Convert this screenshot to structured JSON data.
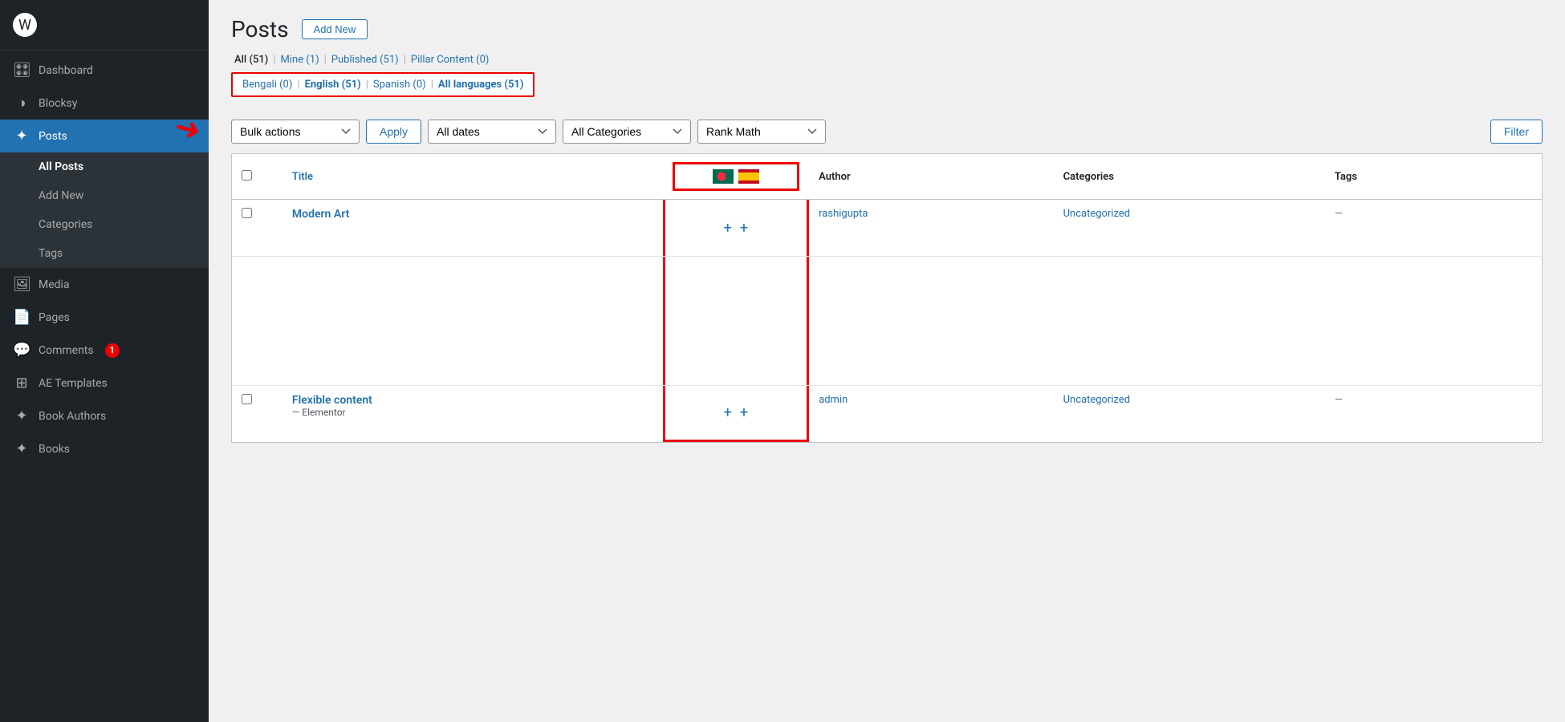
{
  "sidebar": {
    "items": [
      {
        "id": "dashboard",
        "label": "Dashboard",
        "icon": "🎛"
      },
      {
        "id": "blocksy",
        "label": "Blocksy",
        "icon": "◑"
      },
      {
        "id": "posts",
        "label": "Posts",
        "icon": "✦",
        "active": true
      },
      {
        "id": "media",
        "label": "Media",
        "icon": "🖼"
      },
      {
        "id": "pages",
        "label": "Pages",
        "icon": "📄"
      },
      {
        "id": "comments",
        "label": "Comments",
        "icon": "💬",
        "badge": "1"
      },
      {
        "id": "ae-templates",
        "label": "AE Templates",
        "icon": "⊞"
      },
      {
        "id": "book-authors",
        "label": "Book Authors",
        "icon": "✦"
      },
      {
        "id": "books",
        "label": "Books",
        "icon": "✦"
      }
    ],
    "submenu": {
      "parent": "posts",
      "items": [
        {
          "id": "all-posts",
          "label": "All Posts",
          "active": true
        },
        {
          "id": "add-new",
          "label": "Add New"
        },
        {
          "id": "categories",
          "label": "Categories"
        },
        {
          "id": "tags",
          "label": "Tags"
        }
      ]
    }
  },
  "main": {
    "title": "Posts",
    "add_new_label": "Add New",
    "filter_links": [
      {
        "label": "All",
        "count": "51",
        "id": "all"
      },
      {
        "label": "Mine",
        "count": "1",
        "id": "mine"
      },
      {
        "label": "Published",
        "count": "51",
        "id": "published"
      },
      {
        "label": "Pillar Content",
        "count": "0",
        "id": "pillar"
      }
    ],
    "lang_filters": [
      {
        "label": "Bengali",
        "count": "0",
        "bold": false
      },
      {
        "label": "English",
        "count": "51",
        "bold": true
      },
      {
        "label": "Spanish",
        "count": "0",
        "bold": false
      },
      {
        "label": "All languages",
        "count": "51",
        "bold": true
      }
    ],
    "toolbar": {
      "bulk_actions_label": "Bulk actions",
      "apply_label": "Apply",
      "all_dates_label": "All dates",
      "all_categories_label": "All Categories",
      "rank_math_label": "Rank Math",
      "filter_label": "Filter"
    },
    "table": {
      "headers": {
        "title": "Title",
        "author": "Author",
        "categories": "Categories",
        "tags": "Tags"
      },
      "rows": [
        {
          "id": 1,
          "title": "Modern Art",
          "subtitle": "",
          "author": "rashigupta",
          "categories": "Uncategorized",
          "tags": "—"
        },
        {
          "id": 2,
          "title": "Flexible content",
          "subtitle": "— Elementor",
          "author": "admin",
          "categories": "Uncategorized",
          "tags": "—"
        }
      ]
    }
  }
}
